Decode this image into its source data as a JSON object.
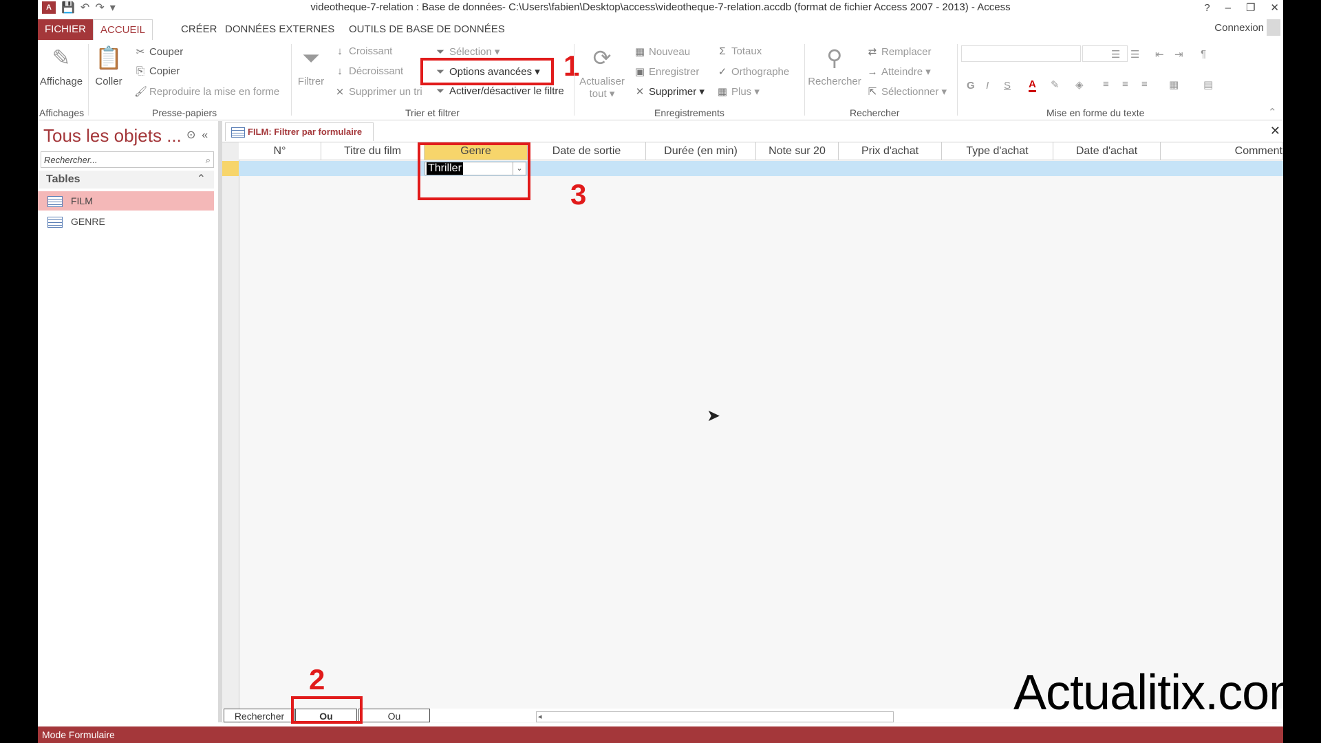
{
  "window": {
    "title": "videotheque-7-relation : Base de données- C:\\Users\\fabien\\Desktop\\access\\videotheque-7-relation.accdb (format de fichier Access 2007 - 2013) - Access",
    "controls": [
      "?",
      "–",
      "❐",
      "✕"
    ]
  },
  "tabs": {
    "file": "FICHIER",
    "home": "ACCUEIL",
    "create": "CRÉER",
    "external": "DONNÉES EXTERNES",
    "dbtools": "OUTILS DE BASE DE DONNÉES",
    "signin": "Connexion"
  },
  "ribbon": {
    "views": {
      "view": "Affichage",
      "group": "Affichages"
    },
    "clipboard": {
      "paste": "Coller",
      "cut": "Couper",
      "copy": "Copier",
      "format_painter": "Reproduire la mise en forme",
      "group": "Presse-papiers"
    },
    "sort_filter": {
      "filter": "Filtrer",
      "ascending": "Croissant",
      "descending": "Décroissant",
      "remove_sort": "Supprimer un tri",
      "selection": "Sélection",
      "advanced": "Options avancées",
      "toggle_filter": "Activer/désactiver le filtre",
      "group": "Trier et filtrer"
    },
    "records": {
      "refresh_1": "Actualiser",
      "refresh_2": "tout",
      "new": "Nouveau",
      "save": "Enregistrer",
      "delete": "Supprimer",
      "totals": "Totaux",
      "spelling": "Orthographe",
      "more": "Plus",
      "group": "Enregistrements"
    },
    "find": {
      "find": "Rechercher",
      "replace": "Remplacer",
      "goto": "Atteindre",
      "select": "Sélectionner",
      "group": "Rechercher"
    },
    "text_format": {
      "bold": "G",
      "italic": "I",
      "underline": "S",
      "group": "Mise en forme du texte"
    }
  },
  "navpane": {
    "title": "Tous les objets ...",
    "search_placeholder": "Rechercher...",
    "section": "Tables",
    "items": [
      {
        "label": "FILM",
        "selected": true
      },
      {
        "label": "GENRE",
        "selected": false
      }
    ]
  },
  "document": {
    "tab_title": "FILM: Filtrer par formulaire",
    "columns": [
      "N°",
      "Titre du film",
      "Genre",
      "Date de sortie",
      "Durée (en min)",
      "Note sur 20",
      "Prix d'achat",
      "Type d'achat",
      "Date d'achat",
      "Comment"
    ],
    "highlighted_column": "Genre",
    "genre_filter_value": "Thriller",
    "bottom_tabs": [
      "Rechercher",
      "Ou",
      "Ou"
    ]
  },
  "annotations": {
    "callout_1": "1",
    "callout_2": "2",
    "callout_3": "3",
    "color": "#e11b1b"
  },
  "watermark": "Actualitix.com",
  "status": "Mode Formulaire",
  "colors": {
    "accent": "#a4373a",
    "highlight": "#f7d56b",
    "row": "#c6e3f7"
  }
}
